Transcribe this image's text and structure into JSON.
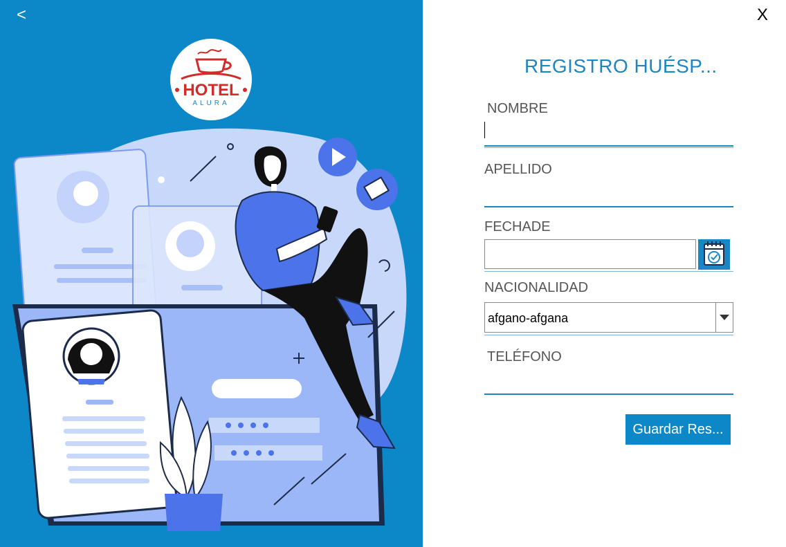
{
  "nav": {
    "back_label": "<",
    "close_label": "X"
  },
  "logo": {
    "text": "HOTEL",
    "subtext": "ALURA"
  },
  "form": {
    "title": "REGISTRO HUÉSP...",
    "nombre": {
      "label": "NOMBRE",
      "value": ""
    },
    "apellido": {
      "label": "APELLIDO",
      "value": ""
    },
    "fecha": {
      "label": "FECHADE",
      "value": ""
    },
    "nacionalidad": {
      "label": "NACIONALIDAD",
      "value": "afgano-afgana"
    },
    "telefono": {
      "label": "TELÉFONO",
      "value": ""
    },
    "save_label": "Guardar Res..."
  },
  "icons": {
    "calendar": "calendar-check-icon",
    "dropdown": "chevron-down-icon"
  },
  "colors": {
    "panel_blue": "#0c88c8",
    "accent": "#1a86c4",
    "illus_light": "#c7d8fb",
    "illus_mid": "#9bb7f7",
    "illus_dark": "#4d73ea"
  }
}
